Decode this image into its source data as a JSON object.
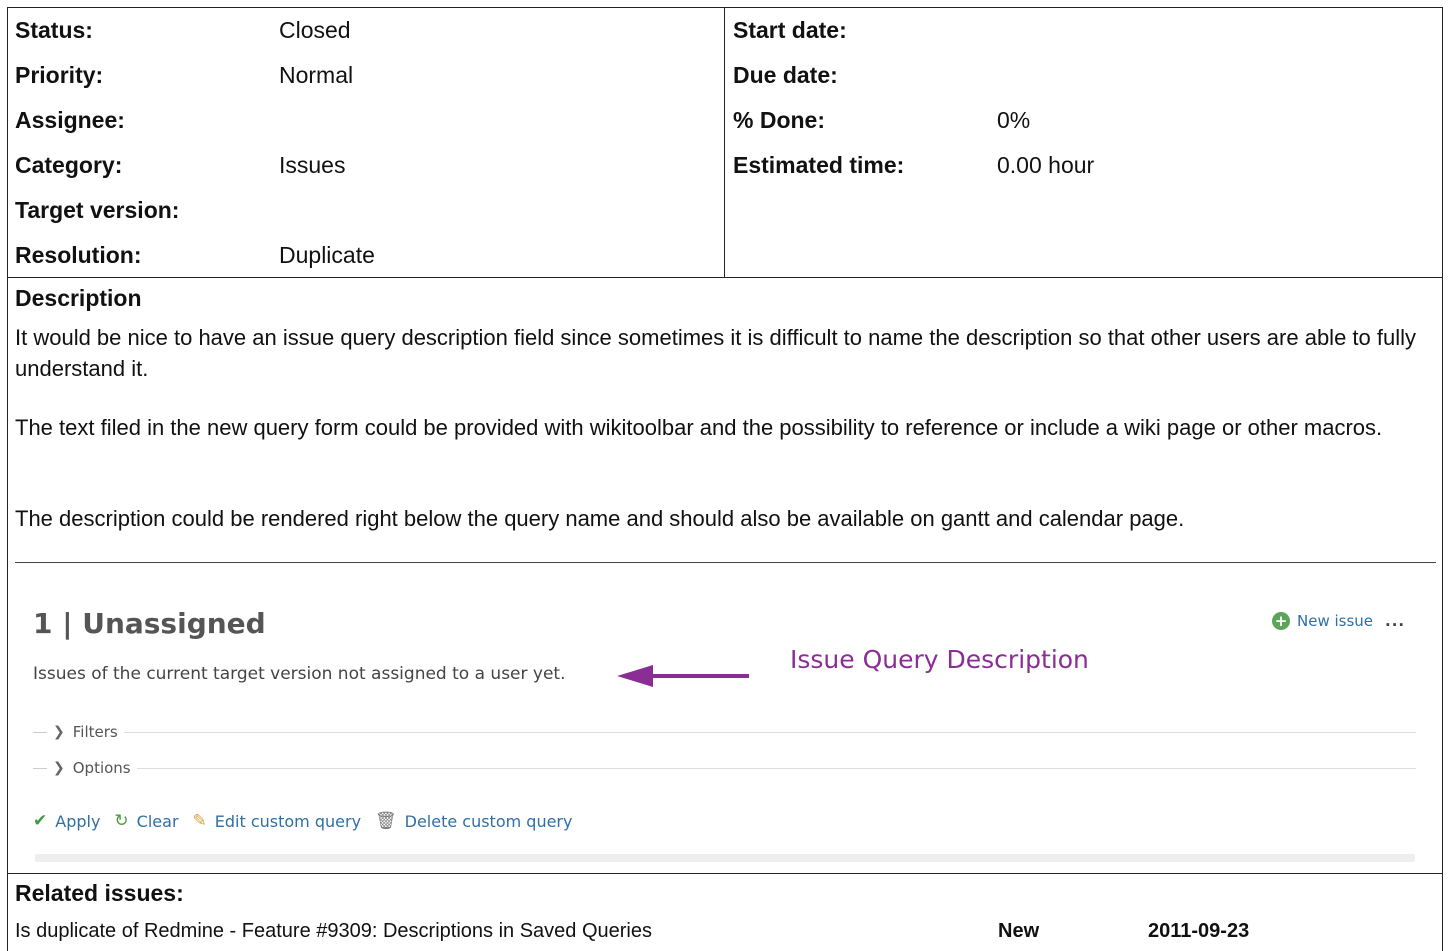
{
  "attributes_left": [
    {
      "label": "Status:",
      "value": "Closed"
    },
    {
      "label": "Priority:",
      "value": "Normal"
    },
    {
      "label": "Assignee:",
      "value": ""
    },
    {
      "label": "Category:",
      "value": "Issues"
    },
    {
      "label": "Target version:",
      "value": ""
    },
    {
      "label": "Resolution:",
      "value": "Duplicate"
    }
  ],
  "attributes_right": [
    {
      "label": "Start date:",
      "value": ""
    },
    {
      "label": "Due date:",
      "value": ""
    },
    {
      "label": "% Done:",
      "value": "0%"
    },
    {
      "label": "Estimated time:",
      "value": "0.00 hour"
    }
  ],
  "description": {
    "heading": "Description",
    "paragraphs": [
      "It would be nice to have an issue query description field since sometimes it is difficult to name the description so that other users are able to fully understand it.",
      "The text filed in the new query form could be provided with wikitoolbar and the possibility to reference or include a wiki page or other macros.",
      "The description could be rendered right below the query name and should also be available on gantt and calendar page."
    ]
  },
  "embedded_screenshot": {
    "title": "1 | Unassigned",
    "query_description": "Issues of the current target version not assigned to a user yet.",
    "annotation": "Issue Query Description",
    "new_issue": "New issue",
    "more": "...",
    "filters": "Filters",
    "options": "Options",
    "actions": {
      "apply": "Apply",
      "clear": "Clear",
      "edit": "Edit custom query",
      "delete": "Delete custom query"
    },
    "colors": {
      "annotation": "#8a2d94",
      "link": "#2f6fa8"
    }
  },
  "related_issues": {
    "heading": "Related issues:",
    "rows": [
      {
        "subject": "Is duplicate of Redmine - Feature #9309: Descriptions in Saved Queries",
        "status": "New",
        "date": "2011-09-23"
      }
    ]
  }
}
